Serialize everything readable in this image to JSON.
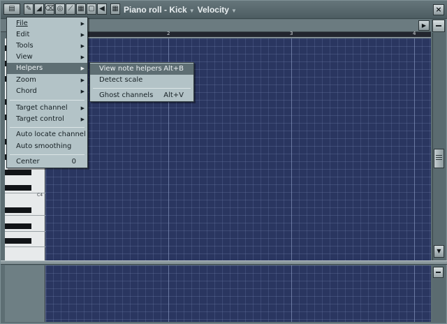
{
  "window": {
    "title": "Piano roll - Kick",
    "title_mode": "Velocity",
    "close_label": "×"
  },
  "toolbar_icons": [
    "menu-icon",
    "pencil-icon",
    "paint-icon",
    "delete-icon",
    "mute-icon",
    "slice-icon",
    "select-icon",
    "zoom-icon",
    "playback-icon",
    "snap-icon"
  ],
  "ruler": {
    "marks": [
      "2",
      "3",
      "4"
    ]
  },
  "keys": {
    "c4_label": "C4"
  },
  "main_menu": {
    "items": [
      {
        "label": "File",
        "submenu": true
      },
      {
        "label": "Edit",
        "submenu": true
      },
      {
        "label": "Tools",
        "submenu": true
      },
      {
        "label": "View",
        "submenu": true
      },
      {
        "label": "Helpers",
        "submenu": true,
        "active": true
      },
      {
        "label": "Zoom",
        "submenu": true
      },
      {
        "label": "Chord",
        "submenu": true
      },
      {
        "label": "Target channel",
        "submenu": true
      },
      {
        "label": "Target control",
        "submenu": true
      },
      {
        "label": "Auto locate channel",
        "submenu": false
      },
      {
        "label": "Auto smoothing",
        "submenu": false
      },
      {
        "label": "Center",
        "value": "0"
      }
    ]
  },
  "helpers_submenu": {
    "items": [
      {
        "label": "View note helpers",
        "shortcut": "Alt+B",
        "active": true
      },
      {
        "label": "Detect scale",
        "shortcut": ""
      },
      {
        "label": "Ghost channels",
        "shortcut": "Alt+V"
      }
    ]
  },
  "colors": {
    "grid": "#2a3660",
    "menu_bg": "#b3c3c7",
    "menu_highlight": "#5e6e73",
    "chrome": "#5d6e73"
  }
}
